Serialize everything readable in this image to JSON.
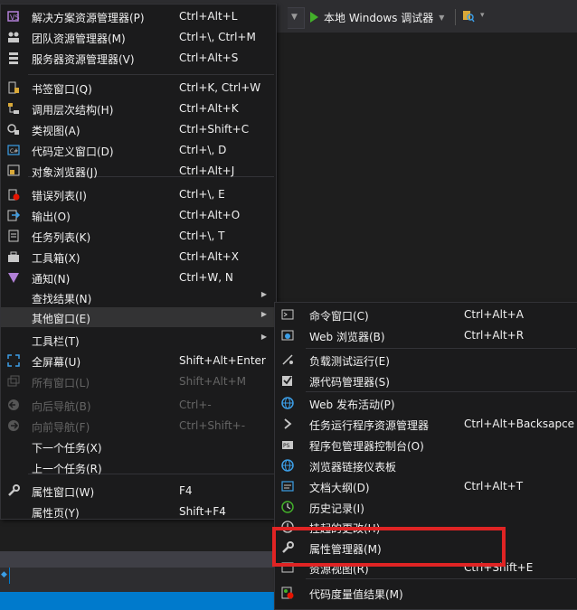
{
  "toolbar": {
    "run_label": "本地 Windows 调试器",
    "run_icon": "play-icon",
    "accent_green": "#43b02a"
  },
  "status_bar": {
    "color": "#007acc"
  },
  "view_menu": {
    "items": [
      {
        "label": "解决方案资源管理器(P)",
        "shortcut": "Ctrl+Alt+L",
        "icon": "solution-explorer-icon"
      },
      {
        "label": "团队资源管理器(M)",
        "shortcut": "Ctrl+\\, Ctrl+M",
        "icon": "team-explorer-icon"
      },
      {
        "label": "服务器资源管理器(V)",
        "shortcut": "Ctrl+Alt+S",
        "icon": "server-explorer-icon"
      },
      {
        "label": "书签窗口(Q)",
        "shortcut": "Ctrl+K, Ctrl+W",
        "icon": "bookmark-icon"
      },
      {
        "label": "调用层次结构(H)",
        "shortcut": "Ctrl+Alt+K",
        "icon": "call-hierarchy-icon"
      },
      {
        "label": "类视图(A)",
        "shortcut": "Ctrl+Shift+C",
        "icon": "class-view-icon"
      },
      {
        "label": "代码定义窗口(D)",
        "shortcut": "Ctrl+\\, D",
        "icon": "code-definition-icon"
      },
      {
        "label": "对象浏览器(J)",
        "shortcut": "Ctrl+Alt+J",
        "icon": "object-browser-icon"
      },
      {
        "label": "错误列表(I)",
        "shortcut": "Ctrl+\\, E",
        "icon": "error-list-icon"
      },
      {
        "label": "输出(O)",
        "shortcut": "Ctrl+Alt+O",
        "icon": "output-icon"
      },
      {
        "label": "任务列表(K)",
        "shortcut": "Ctrl+\\, T",
        "icon": "task-list-icon"
      },
      {
        "label": "工具箱(X)",
        "shortcut": "Ctrl+Alt+X",
        "icon": "toolbox-icon"
      },
      {
        "label": "通知(N)",
        "shortcut": "Ctrl+W, N",
        "icon": "notifications-icon"
      },
      {
        "label": "查找结果(N)",
        "shortcut": "",
        "icon": ""
      },
      {
        "label": "其他窗口(E)",
        "shortcut": "",
        "icon": ""
      },
      {
        "label": "工具栏(T)",
        "shortcut": "",
        "icon": ""
      },
      {
        "label": "全屏幕(U)",
        "shortcut": "Shift+Alt+Enter",
        "icon": "full-screen-icon"
      },
      {
        "label": "所有窗口(L)",
        "shortcut": "Shift+Alt+M",
        "icon": "all-windows-icon"
      },
      {
        "label": "向后导航(B)",
        "shortcut": "Ctrl+-",
        "icon": "navigate-backward-icon"
      },
      {
        "label": "向前导航(F)",
        "shortcut": "Ctrl+Shift+-",
        "icon": "navigate-forward-icon"
      },
      {
        "label": "下一个任务(X)",
        "shortcut": "",
        "icon": ""
      },
      {
        "label": "上一个任务(R)",
        "shortcut": "",
        "icon": ""
      },
      {
        "label": "属性窗口(W)",
        "shortcut": "F4",
        "icon": "wrench-icon"
      },
      {
        "label": "属性页(Y)",
        "shortcut": "Shift+F4",
        "icon": ""
      }
    ]
  },
  "other_windows_menu": {
    "items": [
      {
        "label": "命令窗口(C)",
        "shortcut": "Ctrl+Alt+A",
        "icon": "command-window-icon"
      },
      {
        "label": "Web 浏览器(B)",
        "shortcut": "Ctrl+Alt+R",
        "icon": "web-browser-icon"
      },
      {
        "label": "负载测试运行(E)",
        "shortcut": "",
        "icon": "load-test-icon"
      },
      {
        "label": "源代码管理器(S)",
        "shortcut": "",
        "icon": "source-control-icon"
      },
      {
        "label": "Web 发布活动(P)",
        "shortcut": "",
        "icon": "web-publish-icon"
      },
      {
        "label": "任务运行程序资源管理器",
        "shortcut": "Ctrl+Alt+Backsapce",
        "icon": "task-runner-icon"
      },
      {
        "label": "程序包管理器控制台(O)",
        "shortcut": "",
        "icon": "package-manager-icon"
      },
      {
        "label": "浏览器链接仪表板",
        "shortcut": "",
        "icon": "browser-link-icon"
      },
      {
        "label": "文档大纲(D)",
        "shortcut": "Ctrl+Alt+T",
        "icon": "document-outline-icon"
      },
      {
        "label": "历史记录(I)",
        "shortcut": "",
        "icon": "history-icon"
      },
      {
        "label": "挂起的更改(H)",
        "shortcut": "",
        "icon": "pending-changes-icon"
      },
      {
        "label": "属性管理器(M)",
        "shortcut": "",
        "icon": "wrench-icon"
      },
      {
        "label": "资源视图(R)",
        "shortcut": "Ctrl+Shift+E",
        "icon": "resource-view-icon"
      },
      {
        "label": "代码度量值结果(M)",
        "shortcut": "",
        "icon": "code-metrics-icon"
      }
    ]
  },
  "annotation": {
    "color": "#e02424"
  }
}
